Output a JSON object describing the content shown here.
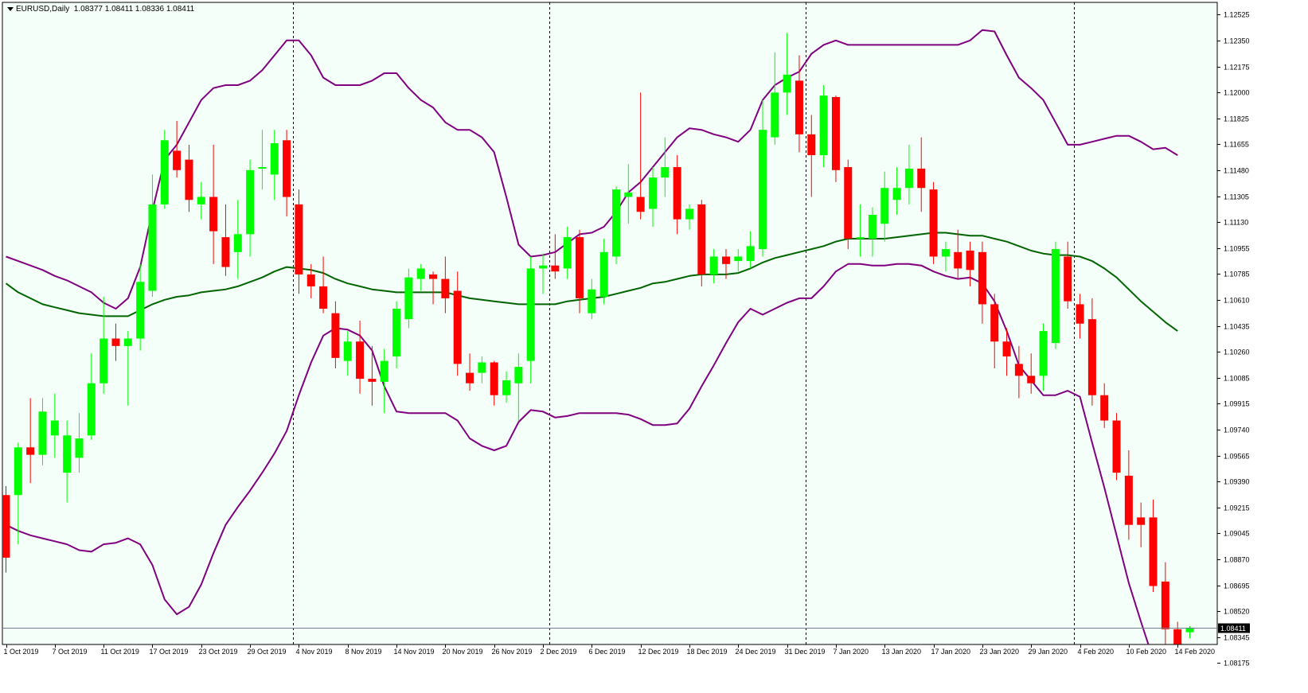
{
  "header": {
    "symbol": "EURUSD,Daily",
    "ohlc": "1.08377 1.08411 1.08336 1.08411"
  },
  "colors": {
    "background": "#f3fff8",
    "bull": "#00ff00",
    "bear": "#ff0000",
    "bollinger": "#800080",
    "ma": "#006400",
    "price_line": "#708090"
  },
  "chart_data": {
    "type": "candlestick",
    "symbol": "EURUSD",
    "timeframe": "Daily",
    "y_ticks": [
      "1.12525",
      "1.12350",
      "1.12175",
      "1.12000",
      "1.11825",
      "1.11655",
      "1.11480",
      "1.11305",
      "1.11130",
      "1.10955",
      "1.10785",
      "1.10610",
      "1.10435",
      "1.10260",
      "1.10085",
      "1.09915",
      "1.09740",
      "1.09565",
      "1.09390",
      "1.09215",
      "1.09045",
      "1.08870",
      "1.08695",
      "1.08520",
      "1.08345",
      "1.08175"
    ],
    "x_ticks": [
      "1 Oct 2019",
      "7 Oct 2019",
      "11 Oct 2019",
      "17 Oct 2019",
      "23 Oct 2019",
      "29 Oct 2019",
      "4 Nov 2019",
      "8 Nov 2019",
      "14 Nov 2019",
      "20 Nov 2019",
      "26 Nov 2019",
      "2 Dec 2019",
      "6 Dec 2019",
      "12 Dec 2019",
      "18 Dec 2019",
      "24 Dec 2019",
      "31 Dec 2019",
      "7 Jan 2020",
      "13 Jan 2020",
      "17 Jan 2020",
      "23 Jan 2020",
      "29 Jan 2020",
      "4 Feb 2020",
      "10 Feb 2020",
      "14 Feb 2020"
    ],
    "x_tick_candle_index": [
      0,
      4,
      8,
      12,
      16,
      20,
      24,
      28,
      32,
      36,
      40,
      44,
      48,
      52,
      56,
      60,
      64,
      68,
      72,
      76,
      80,
      84,
      88,
      92,
      96
    ],
    "period_separators": [
      23,
      44,
      65,
      87
    ],
    "current_price": "1.08411",
    "ylim": [
      1.0815,
      1.1265
    ],
    "candles": [
      {
        "o": 1.093,
        "h": 1.0936,
        "l": 1.0878,
        "c": 1.0888
      },
      {
        "o": 1.093,
        "h": 1.0965,
        "l": 1.0897,
        "c": 1.0962
      },
      {
        "o": 1.0962,
        "h": 1.0995,
        "l": 1.0938,
        "c": 1.0957
      },
      {
        "o": 1.0957,
        "h": 1.0995,
        "l": 1.095,
        "c": 1.0986
      },
      {
        "o": 1.097,
        "h": 1.0998,
        "l": 1.0955,
        "c": 1.098
      },
      {
        "o": 1.0945,
        "h": 1.098,
        "l": 1.0925,
        "c": 1.097
      },
      {
        "o": 1.0955,
        "h": 1.0985,
        "l": 1.0945,
        "c": 1.0968
      },
      {
        "o": 1.097,
        "h": 1.1025,
        "l": 1.0967,
        "c": 1.1005
      },
      {
        "o": 1.1005,
        "h": 1.1063,
        "l": 1.0998,
        "c": 1.1035
      },
      {
        "o": 1.1035,
        "h": 1.1045,
        "l": 1.102,
        "c": 1.103
      },
      {
        "o": 1.103,
        "h": 1.104,
        "l": 1.099,
        "c": 1.1035
      },
      {
        "o": 1.1035,
        "h": 1.1085,
        "l": 1.1027,
        "c": 1.1073
      },
      {
        "o": 1.1067,
        "h": 1.1145,
        "l": 1.1063,
        "c": 1.1125
      },
      {
        "o": 1.1125,
        "h": 1.1175,
        "l": 1.1122,
        "c": 1.1168
      },
      {
        "o": 1.1161,
        "h": 1.1181,
        "l": 1.1143,
        "c": 1.1148
      },
      {
        "o": 1.1155,
        "h": 1.1165,
        "l": 1.112,
        "c": 1.1128
      },
      {
        "o": 1.1125,
        "h": 1.114,
        "l": 1.1115,
        "c": 1.113
      },
      {
        "o": 1.113,
        "h": 1.1165,
        "l": 1.1085,
        "c": 1.1107
      },
      {
        "o": 1.1103,
        "h": 1.1125,
        "l": 1.1077,
        "c": 1.1083
      },
      {
        "o": 1.1093,
        "h": 1.1128,
        "l": 1.1075,
        "c": 1.1105
      },
      {
        "o": 1.1105,
        "h": 1.1155,
        "l": 1.109,
        "c": 1.1148
      },
      {
        "o": 1.115,
        "h": 1.1175,
        "l": 1.1135,
        "c": 1.115
      },
      {
        "o": 1.1145,
        "h": 1.1175,
        "l": 1.1128,
        "c": 1.1166
      },
      {
        "o": 1.1168,
        "h": 1.1175,
        "l": 1.1117,
        "c": 1.113
      },
      {
        "o": 1.1125,
        "h": 1.1135,
        "l": 1.1065,
        "c": 1.1078
      },
      {
        "o": 1.1078,
        "h": 1.1085,
        "l": 1.1062,
        "c": 1.107
      },
      {
        "o": 1.107,
        "h": 1.109,
        "l": 1.1052,
        "c": 1.1055
      },
      {
        "o": 1.1052,
        "h": 1.106,
        "l": 1.1015,
        "c": 1.1022
      },
      {
        "o": 1.102,
        "h": 1.104,
        "l": 1.101,
        "c": 1.1033
      },
      {
        "o": 1.1033,
        "h": 1.1047,
        "l": 1.0998,
        "c": 1.1008
      },
      {
        "o": 1.1008,
        "h": 1.103,
        "l": 1.099,
        "c": 1.1006
      },
      {
        "o": 1.1006,
        "h": 1.1028,
        "l": 1.0985,
        "c": 1.102
      },
      {
        "o": 1.1023,
        "h": 1.106,
        "l": 1.1015,
        "c": 1.1055
      },
      {
        "o": 1.1048,
        "h": 1.1082,
        "l": 1.1042,
        "c": 1.1076
      },
      {
        "o": 1.1075,
        "h": 1.1085,
        "l": 1.1067,
        "c": 1.1082
      },
      {
        "o": 1.1078,
        "h": 1.108,
        "l": 1.1058,
        "c": 1.1075
      },
      {
        "o": 1.1075,
        "h": 1.109,
        "l": 1.1052,
        "c": 1.1062
      },
      {
        "o": 1.1067,
        "h": 1.108,
        "l": 1.101,
        "c": 1.1018
      },
      {
        "o": 1.1012,
        "h": 1.1025,
        "l": 1.1,
        "c": 1.1005
      },
      {
        "o": 1.1012,
        "h": 1.1023,
        "l": 1.1005,
        "c": 1.1019
      },
      {
        "o": 1.1019,
        "h": 1.102,
        "l": 1.099,
        "c": 1.0997
      },
      {
        "o": 1.0997,
        "h": 1.1013,
        "l": 1.0992,
        "c": 1.1007
      },
      {
        "o": 1.1005,
        "h": 1.1025,
        "l": 1.098,
        "c": 1.1016
      },
      {
        "o": 1.102,
        "h": 1.109,
        "l": 1.1005,
        "c": 1.1082
      },
      {
        "o": 1.1082,
        "h": 1.1092,
        "l": 1.1065,
        "c": 1.1084
      },
      {
        "o": 1.1084,
        "h": 1.1105,
        "l": 1.1075,
        "c": 1.108
      },
      {
        "o": 1.1082,
        "h": 1.111,
        "l": 1.1075,
        "c": 1.1103
      },
      {
        "o": 1.1103,
        "h": 1.1108,
        "l": 1.1052,
        "c": 1.1062
      },
      {
        "o": 1.1052,
        "h": 1.1075,
        "l": 1.1048,
        "c": 1.1068
      },
      {
        "o": 1.1063,
        "h": 1.1102,
        "l": 1.1058,
        "c": 1.1093
      },
      {
        "o": 1.109,
        "h": 1.1137,
        "l": 1.1085,
        "c": 1.1135
      },
      {
        "o": 1.113,
        "h": 1.1152,
        "l": 1.1112,
        "c": 1.1133
      },
      {
        "o": 1.113,
        "h": 1.12,
        "l": 1.1115,
        "c": 1.112
      },
      {
        "o": 1.1122,
        "h": 1.115,
        "l": 1.111,
        "c": 1.1143
      },
      {
        "o": 1.1143,
        "h": 1.117,
        "l": 1.113,
        "c": 1.115
      },
      {
        "o": 1.115,
        "h": 1.1158,
        "l": 1.1105,
        "c": 1.1115
      },
      {
        "o": 1.1115,
        "h": 1.1125,
        "l": 1.1108,
        "c": 1.1122
      },
      {
        "o": 1.1125,
        "h": 1.1128,
        "l": 1.107,
        "c": 1.1078
      },
      {
        "o": 1.1078,
        "h": 1.1095,
        "l": 1.1072,
        "c": 1.109
      },
      {
        "o": 1.109,
        "h": 1.1095,
        "l": 1.1075,
        "c": 1.1085
      },
      {
        "o": 1.1087,
        "h": 1.1095,
        "l": 1.108,
        "c": 1.109
      },
      {
        "o": 1.1087,
        "h": 1.1107,
        "l": 1.1082,
        "c": 1.1097
      },
      {
        "o": 1.1095,
        "h": 1.1195,
        "l": 1.109,
        "c": 1.1175
      },
      {
        "o": 1.117,
        "h": 1.1227,
        "l": 1.1165,
        "c": 1.12
      },
      {
        "o": 1.12,
        "h": 1.124,
        "l": 1.1185,
        "c": 1.1212
      },
      {
        "o": 1.1208,
        "h": 1.1225,
        "l": 1.116,
        "c": 1.1172
      },
      {
        "o": 1.1172,
        "h": 1.1185,
        "l": 1.113,
        "c": 1.1158
      },
      {
        "o": 1.1158,
        "h": 1.1205,
        "l": 1.115,
        "c": 1.1198
      },
      {
        "o": 1.1197,
        "h": 1.1198,
        "l": 1.114,
        "c": 1.1148
      },
      {
        "o": 1.115,
        "h": 1.1155,
        "l": 1.1095,
        "c": 1.1102
      },
      {
        "o": 1.1102,
        "h": 1.1125,
        "l": 1.109,
        "c": 1.1103
      },
      {
        "o": 1.1102,
        "h": 1.1123,
        "l": 1.109,
        "c": 1.1118
      },
      {
        "o": 1.1112,
        "h": 1.1147,
        "l": 1.11,
        "c": 1.1136
      },
      {
        "o": 1.1128,
        "h": 1.115,
        "l": 1.1118,
        "c": 1.1136
      },
      {
        "o": 1.1136,
        "h": 1.1165,
        "l": 1.1125,
        "c": 1.1149
      },
      {
        "o": 1.1149,
        "h": 1.117,
        "l": 1.112,
        "c": 1.1136
      },
      {
        "o": 1.1135,
        "h": 1.114,
        "l": 1.1085,
        "c": 1.109
      },
      {
        "o": 1.109,
        "h": 1.11,
        "l": 1.108,
        "c": 1.1095
      },
      {
        "o": 1.1093,
        "h": 1.1108,
        "l": 1.1075,
        "c": 1.1082
      },
      {
        "o": 1.1094,
        "h": 1.11,
        "l": 1.107,
        "c": 1.1081
      },
      {
        "o": 1.1093,
        "h": 1.11,
        "l": 1.1045,
        "c": 1.1058
      },
      {
        "o": 1.1058,
        "h": 1.1065,
        "l": 1.1015,
        "c": 1.1033
      },
      {
        "o": 1.1033,
        "h": 1.1042,
        "l": 1.101,
        "c": 1.1023
      },
      {
        "o": 1.1018,
        "h": 1.103,
        "l": 1.0995,
        "c": 1.101
      },
      {
        "o": 1.101,
        "h": 1.1025,
        "l": 1.0998,
        "c": 1.1005
      },
      {
        "o": 1.101,
        "h": 1.1045,
        "l": 1.1,
        "c": 1.104
      },
      {
        "o": 1.1032,
        "h": 1.11,
        "l": 1.1028,
        "c": 1.1095
      },
      {
        "o": 1.109,
        "h": 1.11,
        "l": 1.1055,
        "c": 1.106
      },
      {
        "o": 1.1058,
        "h": 1.1065,
        "l": 1.1035,
        "c": 1.1045
      },
      {
        "o": 1.1048,
        "h": 1.1062,
        "l": 1.099,
        "c": 1.0997
      },
      {
        "o": 1.0997,
        "h": 1.1005,
        "l": 1.0975,
        "c": 1.098
      },
      {
        "o": 1.098,
        "h": 1.0985,
        "l": 1.094,
        "c": 1.0945
      },
      {
        "o": 1.0943,
        "h": 1.096,
        "l": 1.09,
        "c": 1.091
      },
      {
        "o": 1.0915,
        "h": 1.0925,
        "l": 1.0895,
        "c": 1.091
      },
      {
        "o": 1.0915,
        "h": 1.0927,
        "l": 1.0865,
        "c": 1.0869
      },
      {
        "o": 1.0872,
        "h": 1.0885,
        "l": 1.083,
        "c": 1.084
      },
      {
        "o": 1.084,
        "h": 1.0845,
        "l": 1.0828,
        "c": 1.083
      },
      {
        "o": 1.0838,
        "h": 1.0842,
        "l": 1.0834,
        "c": 1.0841
      }
    ],
    "bollinger_upper": [
      1.109,
      1.1087,
      1.1084,
      1.1081,
      1.1077,
      1.1074,
      1.107,
      1.1066,
      1.1059,
      1.1055,
      1.1062,
      1.1083,
      1.1121,
      1.1155,
      1.1165,
      1.118,
      1.1195,
      1.1203,
      1.1205,
      1.1205,
      1.1208,
      1.1215,
      1.1225,
      1.1235,
      1.1235,
      1.1225,
      1.121,
      1.1205,
      1.1205,
      1.1205,
      1.1208,
      1.1213,
      1.1213,
      1.1203,
      1.1195,
      1.119,
      1.118,
      1.1175,
      1.1175,
      1.117,
      1.116,
      1.113,
      1.1098,
      1.109,
      1.1091,
      1.1093,
      1.1099,
      1.1105,
      1.1106,
      1.111,
      1.112,
      1.1133,
      1.114,
      1.115,
      1.116,
      1.117,
      1.1176,
      1.1175,
      1.1172,
      1.117,
      1.1167,
      1.1175,
      1.1195,
      1.1205,
      1.121,
      1.1214,
      1.1226,
      1.1232,
      1.1235,
      1.1232,
      1.1232,
      1.1232,
      1.1232,
      1.1232,
      1.1232,
      1.1232,
      1.1232,
      1.1232,
      1.1232,
      1.1235,
      1.1242,
      1.1241,
      1.1225,
      1.121,
      1.1203,
      1.1195,
      1.118,
      1.1165,
      1.1165,
      1.1167,
      1.1169,
      1.1171,
      1.1171,
      1.1167,
      1.1162,
      1.1163,
      1.1158
    ],
    "bollinger_lower": [
      1.091,
      1.0906,
      1.0903,
      1.0901,
      1.0899,
      1.0897,
      1.0893,
      1.0892,
      1.0897,
      1.0898,
      1.0901,
      1.0897,
      1.0883,
      1.086,
      1.085,
      1.0855,
      1.087,
      1.0891,
      1.091,
      1.0922,
      1.0933,
      1.0945,
      1.0958,
      1.0973,
      1.0997,
      1.1019,
      1.1037,
      1.1042,
      1.1041,
      1.1037,
      1.1027,
      1.1003,
      1.0986,
      1.0985,
      1.0985,
      1.0985,
      1.0985,
      1.098,
      1.0968,
      1.0963,
      1.096,
      1.0963,
      1.0979,
      1.0987,
      1.0986,
      1.0982,
      1.0983,
      1.0985,
      1.0985,
      1.0985,
      1.0985,
      1.0984,
      1.0981,
      1.0977,
      1.0977,
      1.0978,
      1.0988,
      1.1003,
      1.1017,
      1.1032,
      1.1046,
      1.1055,
      1.1051,
      1.1055,
      1.1059,
      1.1062,
      1.1062,
      1.107,
      1.108,
      1.1085,
      1.1085,
      1.1084,
      1.1084,
      1.1085,
      1.1085,
      1.1084,
      1.108,
      1.1077,
      1.1075,
      1.1076,
      1.1072,
      1.106,
      1.104,
      1.1017,
      1.1007,
      1.0997,
      1.0997,
      1.1,
      1.0996,
      1.0965,
      1.0935,
      1.0903,
      1.0871,
      1.0845,
      1.082,
      1.0797,
      1.0775
    ],
    "ma": [
      1.1072,
      1.1066,
      1.1062,
      1.1058,
      1.1056,
      1.1054,
      1.1052,
      1.1051,
      1.105,
      1.105,
      1.105,
      1.1054,
      1.1058,
      1.1061,
      1.1063,
      1.1064,
      1.1066,
      1.1067,
      1.1068,
      1.107,
      1.1073,
      1.1076,
      1.108,
      1.1083,
      1.1082,
      1.1081,
      1.1079,
      1.1075,
      1.1072,
      1.107,
      1.1068,
      1.1067,
      1.1066,
      1.1066,
      1.1066,
      1.1066,
      1.1066,
      1.1064,
      1.1062,
      1.1061,
      1.106,
      1.1059,
      1.1058,
      1.1058,
      1.1058,
      1.1058,
      1.106,
      1.1061,
      1.1062,
      1.1063,
      1.1065,
      1.1067,
      1.1069,
      1.1072,
      1.1073,
      1.1075,
      1.1077,
      1.1078,
      1.1078,
      1.1078,
      1.1079,
      1.1082,
      1.1086,
      1.1089,
      1.1091,
      1.1093,
      1.1095,
      1.1097,
      1.11,
      1.1102,
      1.1102,
      1.1102,
      1.1102,
      1.1103,
      1.1104,
      1.1105,
      1.1106,
      1.1106,
      1.1105,
      1.1104,
      1.1104,
      1.1102,
      1.11,
      1.1097,
      1.1094,
      1.1092,
      1.1091,
      1.1091,
      1.109,
      1.1087,
      1.1082,
      1.1076,
      1.1068,
      1.106,
      1.1053,
      1.1046,
      1.104
    ]
  }
}
